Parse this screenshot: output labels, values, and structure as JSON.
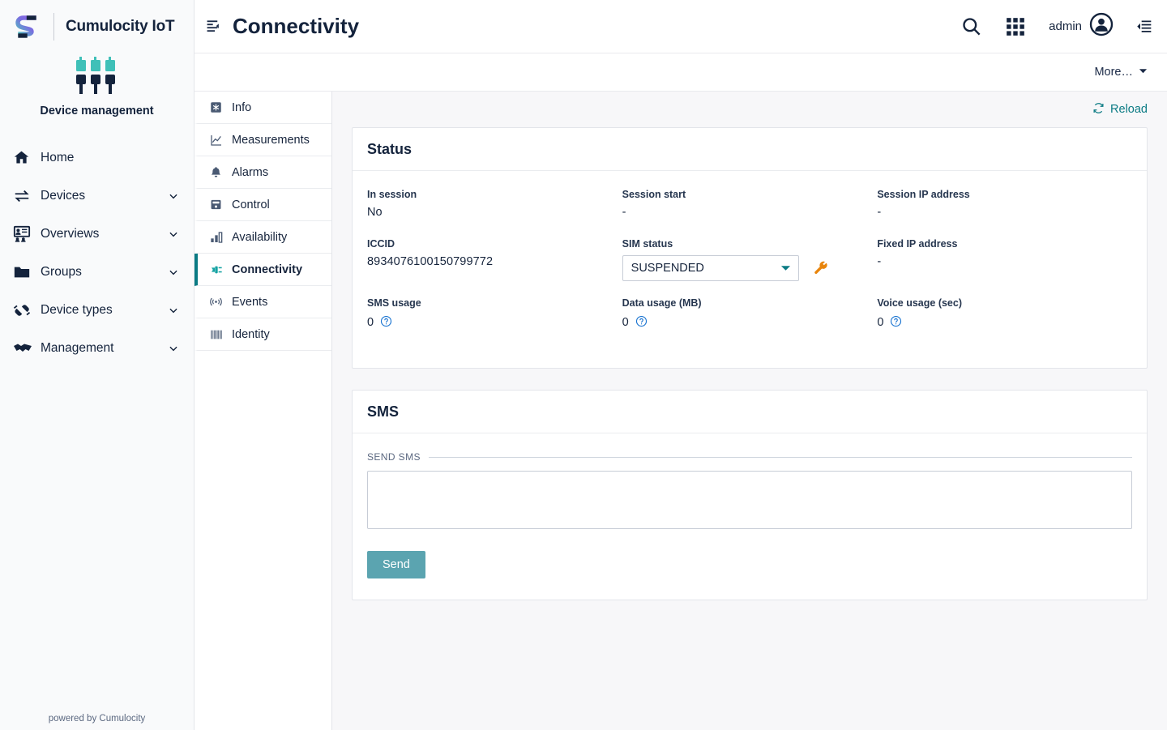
{
  "brand": {
    "logo_icon": "cumulocity-s-logo-icon",
    "name": "Cumulocity IoT",
    "app_icon": "device-management-plugs-icon",
    "app_title": "Device management",
    "powered_by": "powered by Cumulocity"
  },
  "sidebar": {
    "items": [
      {
        "label": "Home",
        "icon": "home-icon",
        "expandable": false
      },
      {
        "label": "Devices",
        "icon": "devices-icon",
        "expandable": true
      },
      {
        "label": "Overviews",
        "icon": "overviews-icon",
        "expandable": true
      },
      {
        "label": "Groups",
        "icon": "folder-icon",
        "expandable": true
      },
      {
        "label": "Device types",
        "icon": "plug-cross-icon",
        "expandable": true
      },
      {
        "label": "Management",
        "icon": "handshake-icon",
        "expandable": true
      }
    ]
  },
  "topbar": {
    "page_icon": "list-detail-icon",
    "title": "Connectivity",
    "search_icon": "search-icon",
    "apps_icon": "app-grid-icon",
    "user_name": "admin",
    "user_icon": "user-avatar-icon",
    "collapse_icon": "collapse-panel-icon"
  },
  "subbar": {
    "more_label": "More…",
    "more_caret_icon": "chevron-down-icon"
  },
  "tabs": [
    {
      "label": "Info",
      "icon": "info-asterisk-icon",
      "active": false
    },
    {
      "label": "Measurements",
      "icon": "chart-line-icon",
      "active": false
    },
    {
      "label": "Alarms",
      "icon": "bell-icon",
      "active": false
    },
    {
      "label": "Control",
      "icon": "control-panel-icon",
      "active": false
    },
    {
      "label": "Availability",
      "icon": "bar-chart-icon",
      "active": false
    },
    {
      "label": "Connectivity",
      "icon": "plug-icon",
      "active": true
    },
    {
      "label": "Events",
      "icon": "broadcast-icon",
      "active": false
    },
    {
      "label": "Identity",
      "icon": "barcode-icon",
      "active": false
    }
  ],
  "content": {
    "reload_label": "Reload",
    "reload_icon": "refresh-icon",
    "status_card": {
      "title": "Status",
      "fields": [
        {
          "label": "In session",
          "value": "No"
        },
        {
          "label": "Session start",
          "value": "-"
        },
        {
          "label": "Session IP address",
          "value": "-"
        },
        {
          "label": "ICCID",
          "value": "8934076100150799772"
        },
        {
          "label": "SIM status",
          "value": "SUSPENDED"
        },
        {
          "label": "Fixed IP address",
          "value": "-"
        },
        {
          "label": "SMS usage",
          "value": "0"
        },
        {
          "label": "Data usage (MB)",
          "value": "0"
        },
        {
          "label": "Voice usage (sec)",
          "value": "0"
        }
      ],
      "sim_status_options": [
        "SUSPENDED"
      ],
      "sim_status_caret_icon": "caret-down-icon",
      "wrench_icon": "wrench-icon",
      "help_icon": "question-circle-icon"
    },
    "sms_card": {
      "title": "SMS",
      "legend": "SEND SMS",
      "textarea_value": "",
      "textarea_placeholder": "",
      "send_label": "Send"
    }
  },
  "colors": {
    "brand_dark": "#14233c",
    "accent_teal": "#0b7b84",
    "active_tab_teal": "#17a3a3",
    "send_button": "#5ba4b0",
    "wrench_orange": "#e8850c",
    "help_blue": "#1772d0",
    "page_bg": "#f7f7f9",
    "sidebar_bg": "#f9fafb"
  }
}
